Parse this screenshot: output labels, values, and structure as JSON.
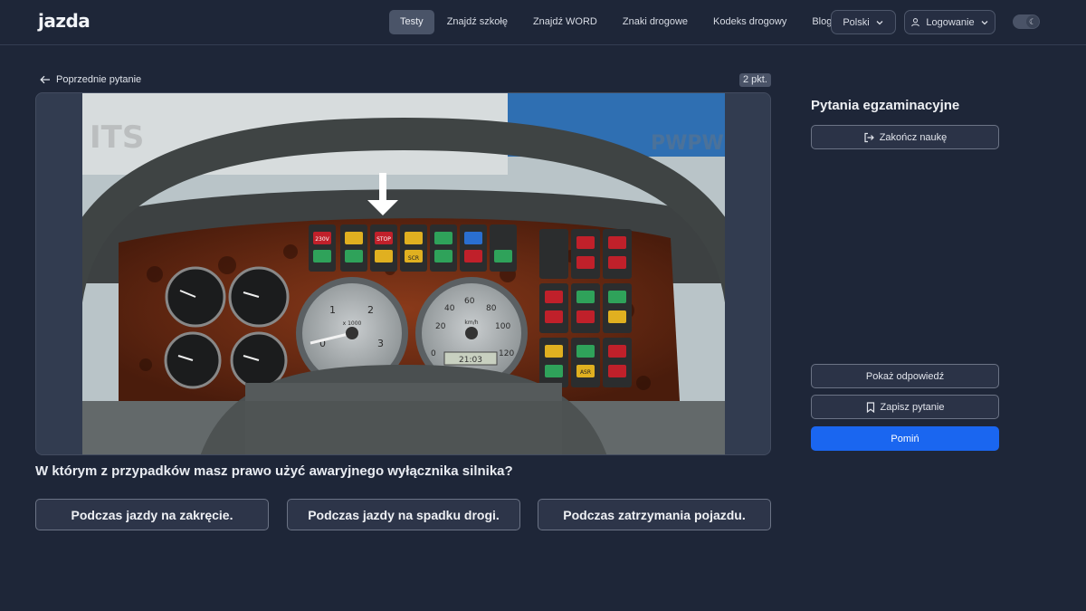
{
  "header": {
    "logo": "jazda",
    "nav": [
      "Testy",
      "Znajdź szkołę",
      "Znajdź WORD",
      "Znaki drogowe",
      "Kodeks drogowy",
      "Blog"
    ],
    "active_nav": "Testy",
    "language": "Polski",
    "login": "Logowanie"
  },
  "question": {
    "prev_label": "Poprzednie pytanie",
    "points": "2 pkt.",
    "text": "W którym z przypadków masz prawo użyć awaryjnego wyłącznika silnika?",
    "answers": [
      "Podczas jazdy na zakręcie.",
      "Podczas jazdy na spadku drogi.",
      "Podczas zatrzymania pojazdu."
    ],
    "media": {
      "watermark_left": "ITS",
      "watermark_right": "PWPW",
      "clock": "21:03",
      "switch_labels": [
        "230V",
        "STOP",
        "SCR",
        "ASR"
      ],
      "gauge_left_ticks": [
        "0",
        "1",
        "2",
        "3"
      ],
      "gauge_left_unit": "x 1000",
      "gauge_right_ticks": [
        "0",
        "20",
        "40",
        "60",
        "80",
        "100",
        "120"
      ],
      "gauge_right_unit": "km/h"
    }
  },
  "sidebar": {
    "title": "Pytania egzaminacyjne",
    "finish": "Zakończ naukę",
    "show_answer": "Pokaż odpowiedź",
    "save": "Zapisz pytanie",
    "skip": "Pomiń"
  },
  "colors": {
    "background": "#1e2638",
    "primary_button": "#1a66f0",
    "logo_accent": "#4c7dff"
  }
}
